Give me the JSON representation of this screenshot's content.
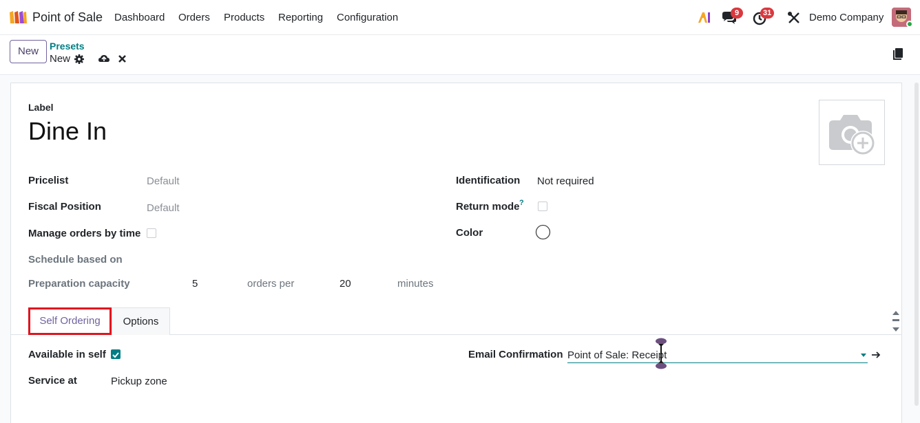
{
  "navbar": {
    "app_name": "Point of Sale",
    "menu": [
      "Dashboard",
      "Orders",
      "Products",
      "Reporting",
      "Configuration"
    ],
    "messages_count": "9",
    "activities_count": "31",
    "company": "Demo Company"
  },
  "control": {
    "new_label": "New",
    "breadcrumb_parent": "Presets",
    "breadcrumb_current": "New"
  },
  "form": {
    "label_caption": "Label",
    "label_value": "Dine In",
    "pricelist_label": "Pricelist",
    "pricelist_value": "Default",
    "fiscal_label": "Fiscal Position",
    "fiscal_value": "Default",
    "manage_orders_label": "Manage orders by time",
    "schedule_label": "Schedule based on",
    "prep_label": "Preparation capacity",
    "prep_orders": "5",
    "prep_orders_per": "orders per",
    "prep_minutes_value": "20",
    "prep_minutes": "minutes",
    "identification_label": "Identification",
    "identification_value": "Not required",
    "return_mode_label": "Return mode",
    "return_mode_help": "?",
    "color_label": "Color"
  },
  "tabs": [
    {
      "label": "Self Ordering",
      "active": true
    },
    {
      "label": "Options",
      "active": false
    }
  ],
  "self_ordering": {
    "available_label": "Available in self",
    "available_checked": true,
    "service_label": "Service at",
    "service_value": "Pickup zone",
    "email_label": "Email Confirmation",
    "email_value": "Point of Sale: Receipt"
  },
  "colors": {
    "accent": "#71639e",
    "teal": "#017e84",
    "badge": "#d9393e",
    "highlight_border": "#e0141e"
  }
}
